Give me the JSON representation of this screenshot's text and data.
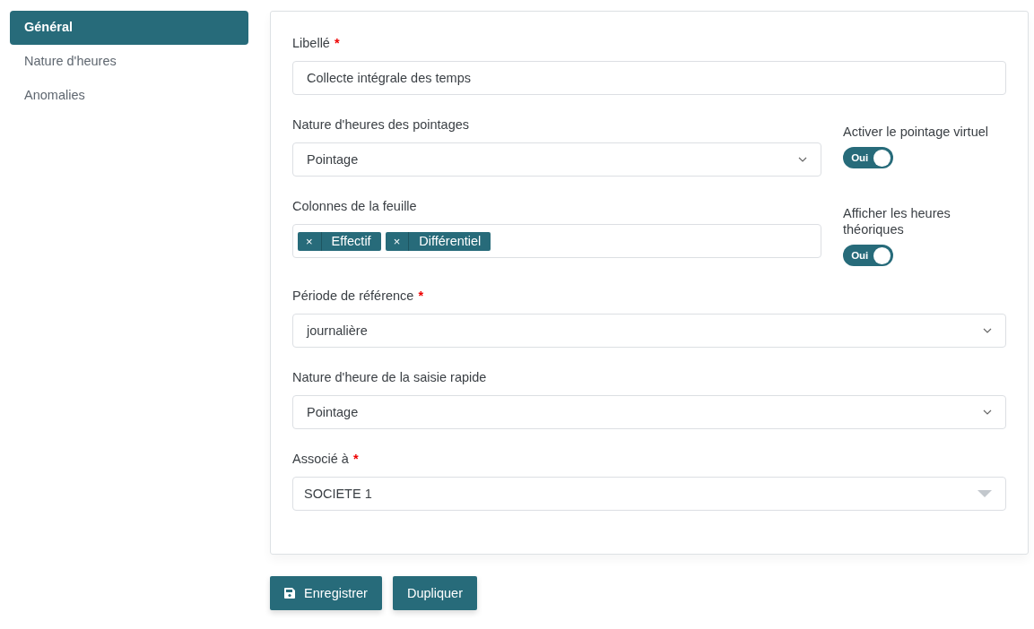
{
  "sidebar": {
    "items": [
      {
        "label": "Général",
        "selected": true
      },
      {
        "label": "Nature d'heures",
        "selected": false
      },
      {
        "label": "Anomalies",
        "selected": false
      }
    ]
  },
  "form": {
    "fields": [
      {
        "kind": "text",
        "label": "Libellé",
        "required_mark": "*",
        "value": "Collecte intégrale des temps"
      },
      {
        "kind": "select",
        "label": "Nature d'heures des pointages",
        "value": "Pointage",
        "side": {
          "label": "Activer le pointage virtuel",
          "toggle_text": "Oui",
          "on": true
        }
      },
      {
        "kind": "tags",
        "label": "Colonnes de la feuille",
        "tags": [
          {
            "remove": "×",
            "label": "Effectif"
          },
          {
            "remove": "×",
            "label": "Différentiel"
          }
        ],
        "side": {
          "label": "Afficher les heures théoriques",
          "toggle_text": "Oui",
          "on": true
        }
      },
      {
        "kind": "select",
        "label": "Période de référence",
        "required_mark": "*",
        "value": "journalière"
      },
      {
        "kind": "select",
        "label": "Nature d'heure de la saisie rapide",
        "value": "Pointage"
      },
      {
        "kind": "combo",
        "label": "Associé à",
        "required_mark": "*",
        "value": "SOCIETE 1"
      }
    ]
  },
  "buttons": [
    {
      "kind": "save",
      "label": "Enregistrer"
    },
    {
      "kind": "plain",
      "label": "Dupliquer"
    }
  ]
}
